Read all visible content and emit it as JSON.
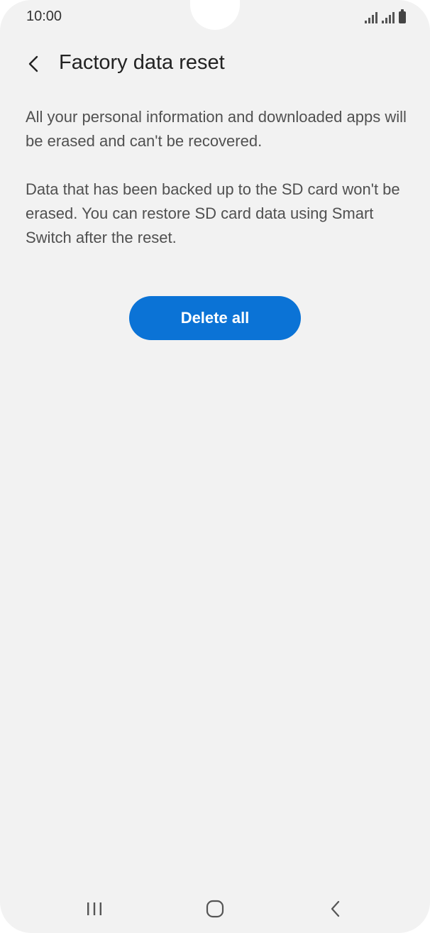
{
  "status_bar": {
    "time": "10:00",
    "icons": [
      "signal-icon",
      "signal-icon",
      "battery-icon"
    ]
  },
  "header": {
    "back_icon": "chevron-left-icon",
    "title": "Factory data reset"
  },
  "content": {
    "paragraphs": [
      "All your personal information and downloaded apps will be erased and can't be recovered.",
      "Data that has been backed up to the SD card won't be erased. You can restore SD card data using Smart Switch after the reset."
    ],
    "delete_button_label": "Delete all"
  },
  "navigation_bar": {
    "recents_icon": "recents-icon",
    "home_icon": "home-icon",
    "back_icon": "back-icon"
  },
  "colors": {
    "accent": "#0b73d6",
    "background": "#f2f2f2"
  }
}
